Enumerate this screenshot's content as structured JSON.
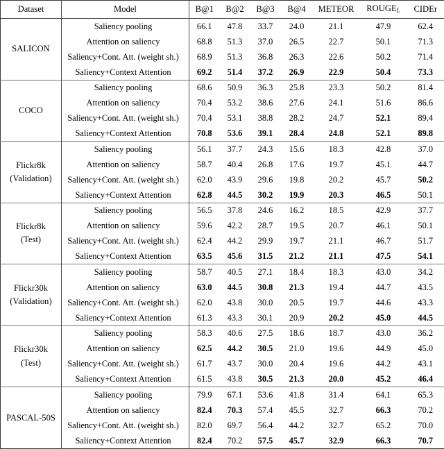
{
  "table": {
    "caption": "",
    "headers": [
      {
        "key": "dataset",
        "label": "Dataset"
      },
      {
        "key": "model",
        "label": "Model"
      },
      {
        "key": "b1",
        "label": "B@1"
      },
      {
        "key": "b2",
        "label": "B@2"
      },
      {
        "key": "b3",
        "label": "B@3"
      },
      {
        "key": "b4",
        "label": "B@4"
      },
      {
        "key": "meteor",
        "label": "METEOR"
      },
      {
        "key": "rouge",
        "label": "ROUGE",
        "subscript": "L"
      },
      {
        "key": "cider",
        "label": "CIDEr"
      }
    ],
    "model_names": [
      "Saliency pooling",
      "Attention on saliency",
      "Saliency+Cont. Att. (weight sh.)",
      "Saliency+Context Attention"
    ],
    "groups": [
      {
        "dataset": "SALICON",
        "dataset_lines": [
          "SALICON"
        ],
        "rows": [
          {
            "model": "Saliency pooling",
            "values": [
              "66.1",
              "47.8",
              "33.7",
              "24.0",
              "21.1",
              "47.9",
              "62.4"
            ],
            "bold": [
              false,
              false,
              false,
              false,
              false,
              false,
              false
            ],
            "model_bold": false
          },
          {
            "model": "Attention on saliency",
            "values": [
              "68.8",
              "51.3",
              "37.0",
              "26.5",
              "22.7",
              "50.1",
              "71.3"
            ],
            "bold": [
              false,
              false,
              false,
              false,
              false,
              false,
              false
            ],
            "model_bold": false
          },
          {
            "model": "Saliency+Cont. Att. (weight sh.)",
            "values": [
              "68.9",
              "51.3",
              "36.8",
              "26.3",
              "22.6",
              "50.2",
              "71.4"
            ],
            "bold": [
              false,
              false,
              false,
              false,
              false,
              false,
              false
            ],
            "model_bold": false
          },
          {
            "model": "Saliency+Context Attention",
            "values": [
              "69.2",
              "51.4",
              "37.2",
              "26.9",
              "22.9",
              "50.4",
              "73.3"
            ],
            "bold": [
              true,
              true,
              true,
              true,
              true,
              true,
              true
            ],
            "model_bold": false
          }
        ]
      },
      {
        "dataset": "COCO",
        "dataset_lines": [
          "COCO"
        ],
        "rows": [
          {
            "model": "Saliency pooling",
            "values": [
              "68.6",
              "50.9",
              "36.3",
              "25.8",
              "23.3",
              "50.2",
              "81.4"
            ],
            "bold": [
              false,
              false,
              false,
              false,
              false,
              false,
              false
            ],
            "model_bold": false
          },
          {
            "model": "Attention on saliency",
            "values": [
              "70.4",
              "53.2",
              "38.6",
              "27.6",
              "24.1",
              "51.6",
              "86.6"
            ],
            "bold": [
              false,
              false,
              false,
              false,
              false,
              false,
              false
            ],
            "model_bold": false
          },
          {
            "model": "Saliency+Cont. Att. (weight sh.)",
            "values": [
              "70.4",
              "53.1",
              "38.8",
              "28.2",
              "24.7",
              "52.1",
              "89.4"
            ],
            "bold": [
              false,
              false,
              false,
              false,
              false,
              true,
              false
            ],
            "model_bold": false
          },
          {
            "model": "Saliency+Context Attention",
            "values": [
              "70.8",
              "53.6",
              "39.1",
              "28.4",
              "24.8",
              "52.1",
              "89.8"
            ],
            "bold": [
              true,
              true,
              true,
              true,
              true,
              true,
              true
            ],
            "model_bold": false
          }
        ]
      },
      {
        "dataset": "Flickr8k (Validation)",
        "dataset_lines": [
          "Flickr8k",
          "(Validation)"
        ],
        "rows": [
          {
            "model": "Saliency pooling",
            "values": [
              "56.1",
              "37.7",
              "24.3",
              "15.6",
              "18.3",
              "42.8",
              "37.0"
            ],
            "bold": [
              false,
              false,
              false,
              false,
              false,
              false,
              false
            ],
            "model_bold": false
          },
          {
            "model": "Attention on saliency",
            "values": [
              "58.7",
              "40.4",
              "26.8",
              "17.6",
              "19.7",
              "45.1",
              "44.7"
            ],
            "bold": [
              false,
              false,
              false,
              false,
              false,
              false,
              false
            ],
            "model_bold": false
          },
          {
            "model": "Saliency+Cont. Att. (weight sh.)",
            "values": [
              "62.0",
              "43.9",
              "29.6",
              "19.8",
              "20.2",
              "45.7",
              "50.2"
            ],
            "bold": [
              false,
              false,
              false,
              false,
              false,
              false,
              true
            ],
            "model_bold": false
          },
          {
            "model": "Saliency+Context Attention",
            "values": [
              "62.8",
              "44.5",
              "30.2",
              "19.9",
              "20.3",
              "46.5",
              "50.1"
            ],
            "bold": [
              true,
              true,
              true,
              true,
              true,
              true,
              false
            ],
            "model_bold": false
          }
        ]
      },
      {
        "dataset": "Flickr8k (Test)",
        "dataset_lines": [
          "Flickr8k",
          "(Test)"
        ],
        "rows": [
          {
            "model": "Saliency pooling",
            "values": [
              "56.5",
              "37.8",
              "24.6",
              "16.2",
              "18.5",
              "42.9",
              "37.7"
            ],
            "bold": [
              false,
              false,
              false,
              false,
              false,
              false,
              false
            ],
            "model_bold": false
          },
          {
            "model": "Attention on saliency",
            "values": [
              "59.6",
              "42.2",
              "28.7",
              "19.5",
              "20.7",
              "46.1",
              "50.1"
            ],
            "bold": [
              false,
              false,
              false,
              false,
              false,
              false,
              false
            ],
            "model_bold": false
          },
          {
            "model": "Saliency+Cont. Att. (weight sh.)",
            "values": [
              "62.4",
              "44.2",
              "29.9",
              "19.7",
              "21.1",
              "46.7",
              "51.7"
            ],
            "bold": [
              false,
              false,
              false,
              false,
              false,
              false,
              false
            ],
            "model_bold": false
          },
          {
            "model": "Saliency+Context Attention",
            "values": [
              "63.5",
              "45.6",
              "31.5",
              "21.2",
              "21.1",
              "47.5",
              "54.1"
            ],
            "bold": [
              true,
              true,
              true,
              true,
              true,
              true,
              true
            ],
            "model_bold": false
          }
        ]
      },
      {
        "dataset": "Flickr30k (Validation)",
        "dataset_lines": [
          "Flickr30k",
          "(Validation)"
        ],
        "rows": [
          {
            "model": "Saliency pooling",
            "values": [
              "58.7",
              "40.5",
              "27.1",
              "18.4",
              "18.3",
              "43.0",
              "34.2"
            ],
            "bold": [
              false,
              false,
              false,
              false,
              false,
              false,
              false
            ],
            "model_bold": false
          },
          {
            "model": "Attention on saliency",
            "values": [
              "63.0",
              "44.5",
              "30.8",
              "21.3",
              "19.4",
              "44.7",
              "43.5"
            ],
            "bold": [
              true,
              true,
              true,
              true,
              false,
              false,
              false
            ],
            "model_bold": false
          },
          {
            "model": "Saliency+Cont. Att. (weight sh.)",
            "values": [
              "62.0",
              "43.8",
              "30.0",
              "20.5",
              "19.7",
              "44.6",
              "43.3"
            ],
            "bold": [
              false,
              false,
              false,
              false,
              false,
              false,
              false
            ],
            "model_bold": false
          },
          {
            "model": "Saliency+Context Attention",
            "values": [
              "61.3",
              "43.3",
              "30.1",
              "20.9",
              "20.2",
              "45.0",
              "44.5"
            ],
            "bold": [
              false,
              false,
              false,
              false,
              true,
              true,
              true
            ],
            "model_bold": false
          }
        ]
      },
      {
        "dataset": "Flickr30k (Test)",
        "dataset_lines": [
          "Flickr30k",
          "(Test)"
        ],
        "rows": [
          {
            "model": "Saliency pooling",
            "values": [
              "58.3",
              "40.6",
              "27.5",
              "18.6",
              "18.7",
              "43.0",
              "36.2"
            ],
            "bold": [
              false,
              false,
              false,
              false,
              false,
              false,
              false
            ],
            "model_bold": false
          },
          {
            "model": "Attention on saliency",
            "values": [
              "62.5",
              "44.2",
              "30.5",
              "21.0",
              "19.6",
              "44.9",
              "45.0"
            ],
            "bold": [
              true,
              true,
              true,
              false,
              false,
              false,
              false
            ],
            "model_bold": false
          },
          {
            "model": "Saliency+Cont. Att. (weight sh.)",
            "values": [
              "61.7",
              "43.7",
              "30.0",
              "20.4",
              "19.6",
              "44.2",
              "43.1"
            ],
            "bold": [
              false,
              false,
              false,
              false,
              false,
              false,
              false
            ],
            "model_bold": false
          },
          {
            "model": "Saliency+Context Attention",
            "values": [
              "61.5",
              "43.8",
              "30.5",
              "21.3",
              "20.0",
              "45.2",
              "46.4"
            ],
            "bold": [
              false,
              false,
              true,
              true,
              true,
              true,
              true
            ],
            "model_bold": false
          }
        ]
      },
      {
        "dataset": "PASCAL-50S",
        "dataset_lines": [
          "PASCAL-50S"
        ],
        "rows": [
          {
            "model": "Saliency pooling",
            "values": [
              "79.9",
              "67.1",
              "53.6",
              "41.8",
              "31.4",
              "64.1",
              "65.3"
            ],
            "bold": [
              false,
              false,
              false,
              false,
              false,
              false,
              false
            ],
            "model_bold": false
          },
          {
            "model": "Attention on saliency",
            "values": [
              "82.4",
              "70.3",
              "57.4",
              "45.5",
              "32.7",
              "66.3",
              "70.2"
            ],
            "bold": [
              true,
              true,
              false,
              false,
              false,
              true,
              false
            ],
            "model_bold": false
          },
          {
            "model": "Saliency+Cont. Att. (weight sh.)",
            "values": [
              "82.0",
              "69.7",
              "56.4",
              "44.2",
              "32.7",
              "65.2",
              "70.0"
            ],
            "bold": [
              false,
              false,
              false,
              false,
              false,
              false,
              false
            ],
            "model_bold": false
          },
          {
            "model": "Saliency+Context Attention",
            "values": [
              "82.4",
              "70.2",
              "57.5",
              "45.7",
              "32.9",
              "66.3",
              "70.7"
            ],
            "bold": [
              true,
              false,
              true,
              true,
              true,
              true,
              true
            ],
            "model_bold": false
          }
        ]
      }
    ]
  }
}
